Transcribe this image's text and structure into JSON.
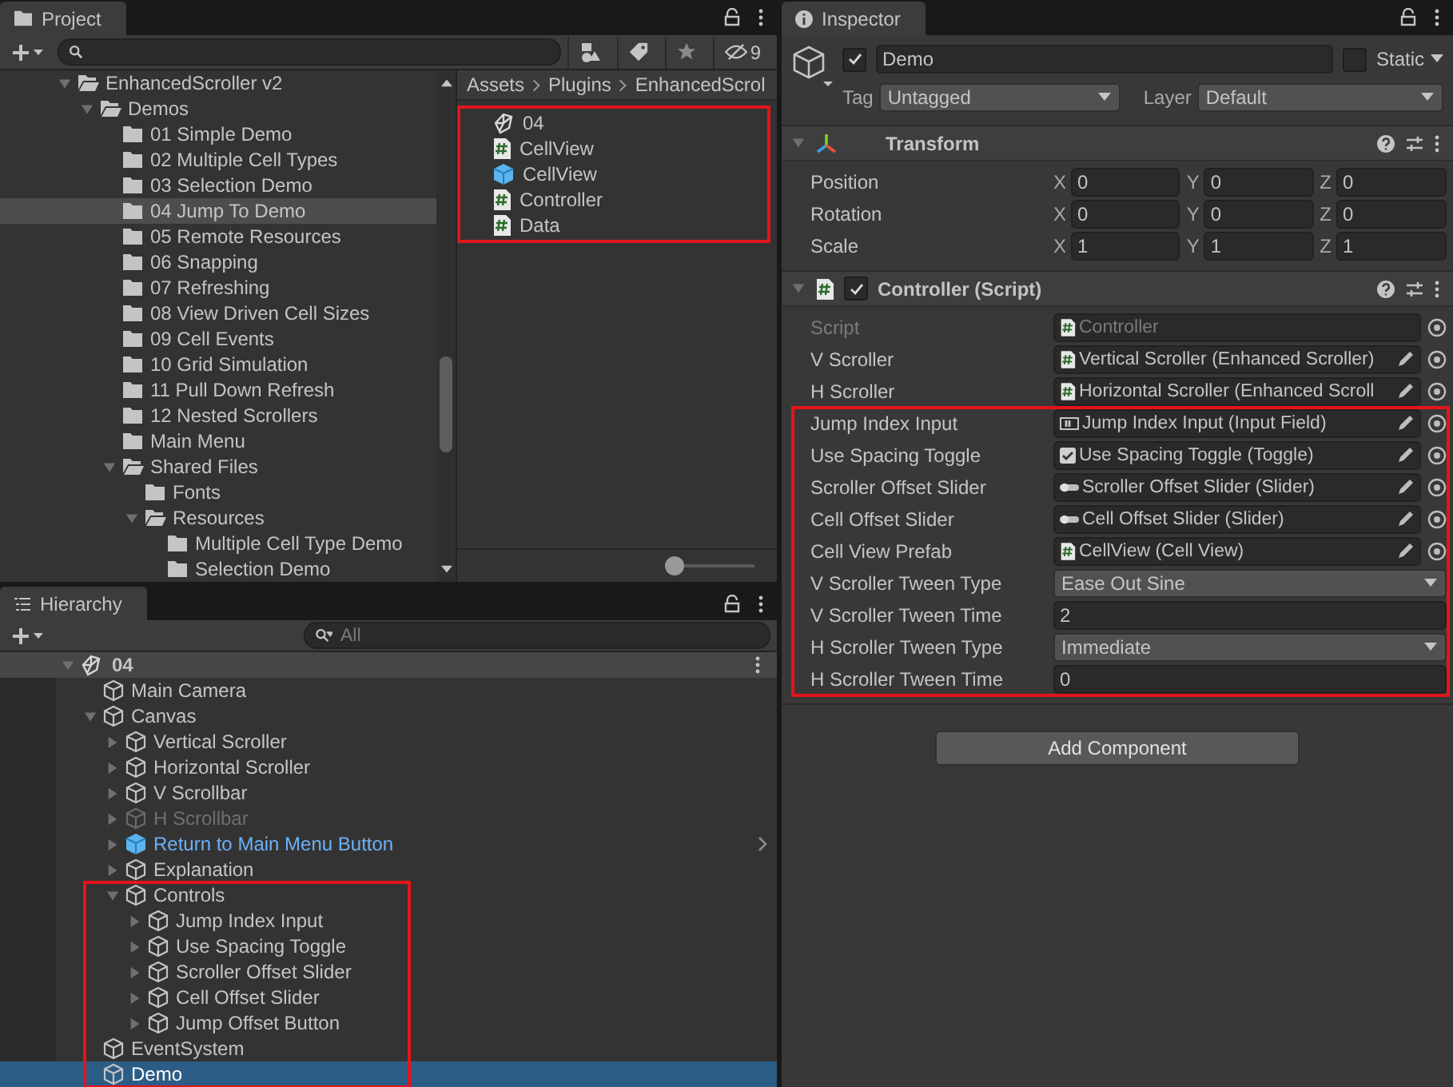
{
  "project": {
    "tab": "Project",
    "filter_count": "9",
    "tree": [
      {
        "label": "EnhancedScroller v2",
        "expanded": true,
        "selected": false,
        "children": [
          {
            "label": "Demos",
            "expanded": true,
            "selected": false,
            "children": [
              {
                "label": "01 Simple Demo",
                "selected": false
              },
              {
                "label": "02 Multiple Cell Types",
                "selected": false
              },
              {
                "label": "03 Selection Demo",
                "selected": false
              },
              {
                "label": "04 Jump To Demo",
                "selected": true
              },
              {
                "label": "05 Remote Resources",
                "selected": false
              },
              {
                "label": "06 Snapping",
                "selected": false
              },
              {
                "label": "07 Refreshing",
                "selected": false
              },
              {
                "label": "08 View Driven Cell Sizes",
                "selected": false
              },
              {
                "label": "09 Cell Events",
                "selected": false
              },
              {
                "label": "10 Grid Simulation",
                "selected": false
              },
              {
                "label": "11 Pull Down Refresh",
                "selected": false
              },
              {
                "label": "12 Nested Scrollers",
                "selected": false
              },
              {
                "label": "Main Menu",
                "selected": false
              },
              {
                "label": "Shared Files",
                "expanded": true,
                "selected": false,
                "children": [
                  {
                    "label": "Fonts",
                    "selected": false
                  },
                  {
                    "label": "Resources",
                    "expanded": true,
                    "selected": false,
                    "children": [
                      {
                        "label": "Multiple Cell Type Demo",
                        "selected": false
                      },
                      {
                        "label": "Selection Demo",
                        "selected": false
                      }
                    ]
                  }
                ]
              }
            ]
          }
        ]
      }
    ],
    "breadcrumb": [
      "Assets",
      "Plugins",
      "EnhancedScrol"
    ],
    "files": [
      {
        "label": "04",
        "kind": "scene",
        "highlighted": true
      },
      {
        "label": "CellView",
        "kind": "script",
        "highlighted": true
      },
      {
        "label": "CellView",
        "kind": "prefab",
        "highlighted": true
      },
      {
        "label": "Controller",
        "kind": "script",
        "highlighted": true
      },
      {
        "label": "Data",
        "kind": "script",
        "highlighted": true
      }
    ],
    "zoom_slider": {
      "level": 0
    }
  },
  "hierarchy": {
    "tab": "Hierarchy",
    "search_placeholder": "All",
    "scene": {
      "label": "04",
      "expanded": true
    },
    "tree": [
      {
        "label": "Main Camera",
        "kind": "object",
        "active": true,
        "selected": false,
        "highlighted": false
      },
      {
        "label": "Canvas",
        "kind": "object",
        "active": true,
        "selected": false,
        "highlighted": false,
        "expanded": true,
        "children": [
          {
            "label": "Vertical Scroller",
            "kind": "object",
            "active": true,
            "selected": false,
            "highlighted": false,
            "expanded": false
          },
          {
            "label": "Horizontal Scroller",
            "kind": "object",
            "active": true,
            "selected": false,
            "highlighted": false,
            "expanded": false
          },
          {
            "label": "V Scrollbar",
            "kind": "object",
            "active": true,
            "selected": false,
            "highlighted": false,
            "expanded": false
          },
          {
            "label": "H Scrollbar",
            "kind": "object",
            "active": false,
            "selected": false,
            "highlighted": false,
            "expanded": false
          },
          {
            "label": "Return to Main Menu Button",
            "kind": "prefab",
            "active": true,
            "selected": false,
            "highlighted": false,
            "expanded": false
          },
          {
            "label": "Explanation",
            "kind": "object",
            "active": true,
            "selected": false,
            "highlighted": false,
            "expanded": false
          },
          {
            "label": "Controls",
            "kind": "object",
            "active": true,
            "selected": false,
            "highlighted": true,
            "expanded": true,
            "children": [
              {
                "label": "Jump Index Input",
                "kind": "object",
                "active": true,
                "selected": false,
                "highlighted": true,
                "expanded": false
              },
              {
                "label": "Use Spacing Toggle",
                "kind": "object",
                "active": true,
                "selected": false,
                "highlighted": true,
                "expanded": false
              },
              {
                "label": "Scroller Offset Slider",
                "kind": "object",
                "active": true,
                "selected": false,
                "highlighted": true,
                "expanded": false
              },
              {
                "label": "Cell Offset Slider",
                "kind": "object",
                "active": true,
                "selected": false,
                "highlighted": true,
                "expanded": false
              },
              {
                "label": "Jump Offset Button",
                "kind": "object",
                "active": true,
                "selected": false,
                "highlighted": true,
                "expanded": false
              }
            ]
          }
        ]
      },
      {
        "label": "EventSystem",
        "kind": "object",
        "active": true,
        "selected": false,
        "highlighted": true
      },
      {
        "label": "Demo",
        "kind": "object",
        "active": true,
        "selected": true,
        "highlighted": true
      }
    ]
  },
  "inspector": {
    "tab": "Inspector",
    "object": {
      "name": "Demo",
      "active": true,
      "static_label": "Static",
      "static": false,
      "tag_label": "Tag",
      "tag": "Untagged",
      "layer_label": "Layer",
      "layer": "Default"
    },
    "components": [
      {
        "kind": "transform",
        "title": "Transform",
        "expanded": true,
        "rows": [
          {
            "label": "Position",
            "values": [
              {
                "axis": "X",
                "value": "0"
              },
              {
                "axis": "Y",
                "value": "0"
              },
              {
                "axis": "Z",
                "value": "0"
              }
            ]
          },
          {
            "label": "Rotation",
            "values": [
              {
                "axis": "X",
                "value": "0"
              },
              {
                "axis": "Y",
                "value": "0"
              },
              {
                "axis": "Z",
                "value": "0"
              }
            ]
          },
          {
            "label": "Scale",
            "values": [
              {
                "axis": "X",
                "value": "1"
              },
              {
                "axis": "Y",
                "value": "1"
              },
              {
                "axis": "Z",
                "value": "1"
              }
            ]
          }
        ]
      },
      {
        "kind": "script",
        "title": "Controller (Script)",
        "expanded": true,
        "enabled": true,
        "fields": [
          {
            "label": "Script",
            "kind": "script_ref",
            "value": "Controller",
            "disabled": true,
            "highlighted": false
          },
          {
            "label": "V Scroller",
            "kind": "script_ref",
            "value": "Vertical Scroller (Enhanced Scroller)",
            "disabled": false,
            "highlighted": false
          },
          {
            "label": "H Scroller",
            "kind": "script_ref",
            "value": "Horizontal Scroller (Enhanced Scroll",
            "disabled": false,
            "highlighted": false
          },
          {
            "label": "Jump Index Input",
            "kind": "input_ref",
            "value": "Jump Index Input (Input Field)",
            "disabled": false,
            "highlighted": true
          },
          {
            "label": "Use Spacing Toggle",
            "kind": "toggle_ref",
            "value": "Use Spacing Toggle (Toggle)",
            "disabled": false,
            "highlighted": true
          },
          {
            "label": "Scroller Offset Slider",
            "kind": "slider_ref",
            "value": "Scroller Offset Slider (Slider)",
            "disabled": false,
            "highlighted": true
          },
          {
            "label": "Cell Offset Slider",
            "kind": "slider_ref",
            "value": "Cell Offset Slider (Slider)",
            "disabled": false,
            "highlighted": true
          },
          {
            "label": "Cell View Prefab",
            "kind": "script_ref",
            "value": "CellView (Cell View)",
            "disabled": false,
            "highlighted": true
          },
          {
            "label": "V Scroller Tween Type",
            "kind": "dropdown",
            "value": "Ease Out Sine",
            "highlighted": true
          },
          {
            "label": "V Scroller Tween Time",
            "kind": "number",
            "value": "2",
            "highlighted": true
          },
          {
            "label": "H Scroller Tween Type",
            "kind": "dropdown",
            "value": "Immediate",
            "highlighted": true
          },
          {
            "label": "H Scroller Tween Time",
            "kind": "number",
            "value": "0",
            "highlighted": true
          }
        ]
      }
    ],
    "add_button": "Add Component"
  }
}
